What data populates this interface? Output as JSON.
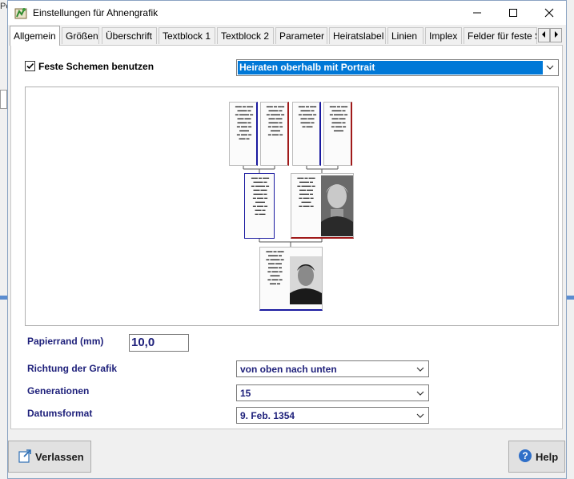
{
  "window": {
    "title": "Einstellungen für Ahnengrafik"
  },
  "background": {
    "left_fragment": "Pe"
  },
  "tabs": [
    {
      "label": "Allgemein"
    },
    {
      "label": "Größen"
    },
    {
      "label": "Überschrift"
    },
    {
      "label": "Textblock 1"
    },
    {
      "label": "Textblock 2"
    },
    {
      "label": "Parameter"
    },
    {
      "label": "Heiratslabel"
    },
    {
      "label": "Linien"
    },
    {
      "label": "Implex"
    },
    {
      "label": "Felder für feste S"
    }
  ],
  "scheme": {
    "checkbox_label": "Feste Schemen benutzen",
    "checked": true,
    "selected_value": "Heiraten oberhalb mit Portrait"
  },
  "fields": {
    "paper_margin_label": "Papierrand (mm)",
    "paper_margin_value": "10,0",
    "direction_label": "Richtung der Grafik",
    "direction_value": "von oben nach unten",
    "generations_label": "Generationen",
    "generations_value": "15",
    "date_format_label": "Datumsformat",
    "date_format_value": "9. Feb. 1354"
  },
  "buttons": {
    "exit_label": "Verlassen",
    "help_label": "Help"
  },
  "colors": {
    "label_blue": "#1d1f7a",
    "selection_blue": "#0078d7",
    "male_border": "#1a1aa0",
    "female_border": "#a01a1a"
  }
}
